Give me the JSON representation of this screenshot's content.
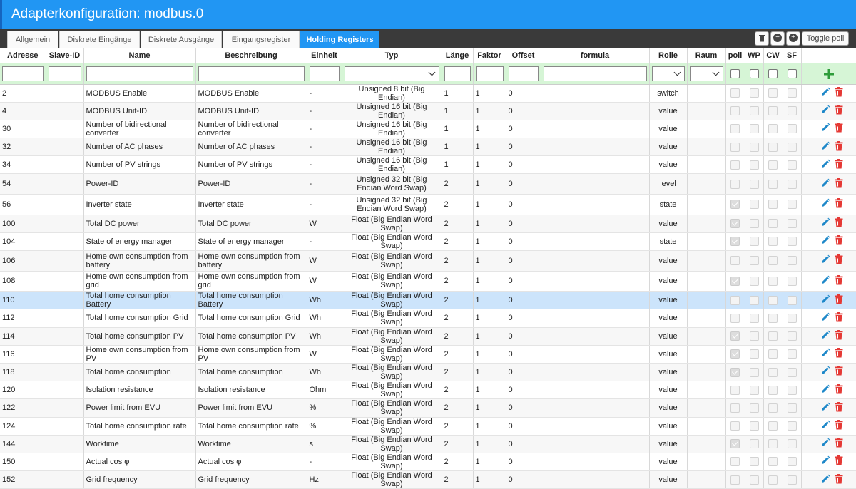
{
  "title": "Adapterkonfiguration: modbus.0",
  "tabs": [
    {
      "label": "Allgemein"
    },
    {
      "label": "Diskrete Eingänge"
    },
    {
      "label": "Diskrete Ausgänge"
    },
    {
      "label": "Eingangsregister"
    },
    {
      "label": "Holding Registers"
    }
  ],
  "toolbar": {
    "toggle_poll": "Toggle poll"
  },
  "columns": [
    "Adresse",
    "Slave-ID",
    "Name",
    "Beschreibung",
    "Einheit",
    "Typ",
    "Länge",
    "Faktor",
    "Offset",
    "formula",
    "Rolle",
    "Raum",
    "poll",
    "WP",
    "CW",
    "SF"
  ],
  "rows": [
    {
      "addr": "2",
      "name": "MODBUS Enable",
      "desc": "MODBUS Enable",
      "unit": "-",
      "type": "Unsigned 8 bit (Big Endian)",
      "len": "1",
      "factor": "1",
      "offset": "0",
      "role": "switch",
      "poll": false
    },
    {
      "addr": "4",
      "name": "MODBUS Unit-ID",
      "desc": "MODBUS Unit-ID",
      "unit": "-",
      "type": "Unsigned 16 bit (Big Endian)",
      "len": "1",
      "factor": "1",
      "offset": "0",
      "role": "value",
      "poll": false
    },
    {
      "addr": "30",
      "name": "Number of bidirectional converter",
      "desc": "Number of bidirectional converter",
      "unit": "-",
      "type": "Unsigned 16 bit (Big Endian)",
      "len": "1",
      "factor": "1",
      "offset": "0",
      "role": "value",
      "poll": false
    },
    {
      "addr": "32",
      "name": "Number of AC phases",
      "desc": "Number of AC phases",
      "unit": "-",
      "type": "Unsigned 16 bit (Big Endian)",
      "len": "1",
      "factor": "1",
      "offset": "0",
      "role": "value",
      "poll": false
    },
    {
      "addr": "34",
      "name": "Number of PV strings",
      "desc": "Number of PV strings",
      "unit": "-",
      "type": "Unsigned 16 bit (Big Endian)",
      "len": "1",
      "factor": "1",
      "offset": "0",
      "role": "value",
      "poll": false
    },
    {
      "addr": "54",
      "name": "Power-ID",
      "desc": "Power-ID",
      "unit": "-",
      "type": "Unsigned 32 bit (Big Endian Word Swap)",
      "len": "2",
      "factor": "1",
      "offset": "0",
      "role": "level",
      "poll": false,
      "tall": true
    },
    {
      "addr": "56",
      "name": "Inverter state",
      "desc": "Inverter state",
      "unit": "-",
      "type": "Unsigned 32 bit (Big Endian Word Swap)",
      "len": "2",
      "factor": "1",
      "offset": "0",
      "role": "state",
      "poll": true,
      "tall": true
    },
    {
      "addr": "100",
      "name": "Total DC power",
      "desc": "Total DC power",
      "unit": "W",
      "type": "Float (Big Endian Word Swap)",
      "len": "2",
      "factor": "1",
      "offset": "0",
      "role": "value",
      "poll": true
    },
    {
      "addr": "104",
      "name": "State of energy manager",
      "desc": "State of energy manager",
      "unit": "-",
      "type": "Float (Big Endian Word Swap)",
      "len": "2",
      "factor": "1",
      "offset": "0",
      "role": "state",
      "poll": true
    },
    {
      "addr": "106",
      "name": "Home own consumption from battery",
      "desc": "Home own consumption from battery",
      "unit": "W",
      "type": "Float (Big Endian Word Swap)",
      "len": "2",
      "factor": "1",
      "offset": "0",
      "role": "value",
      "poll": false,
      "tall": true
    },
    {
      "addr": "108",
      "name": "Home own consumption from grid",
      "desc": "Home own consumption from grid",
      "unit": "W",
      "type": "Float (Big Endian Word Swap)",
      "len": "2",
      "factor": "1",
      "offset": "0",
      "role": "value",
      "poll": true,
      "tall": true
    },
    {
      "addr": "110",
      "name": "Total home consumption Battery",
      "desc": "Total home consumption Battery",
      "unit": "Wh",
      "type": "Float (Big Endian Word Swap)",
      "len": "2",
      "factor": "1",
      "offset": "0",
      "role": "value",
      "poll": false,
      "selected": true
    },
    {
      "addr": "112",
      "name": "Total home consumption Grid",
      "desc": "Total home consumption Grid",
      "unit": "Wh",
      "type": "Float (Big Endian Word Swap)",
      "len": "2",
      "factor": "1",
      "offset": "0",
      "role": "value",
      "poll": false
    },
    {
      "addr": "114",
      "name": "Total home consumption PV",
      "desc": "Total home consumption PV",
      "unit": "Wh",
      "type": "Float (Big Endian Word Swap)",
      "len": "2",
      "factor": "1",
      "offset": "0",
      "role": "value",
      "poll": true
    },
    {
      "addr": "116",
      "name": "Home own consumption from PV",
      "desc": "Home own consumption from PV",
      "unit": "W",
      "type": "Float (Big Endian Word Swap)",
      "len": "2",
      "factor": "1",
      "offset": "0",
      "role": "value",
      "poll": true
    },
    {
      "addr": "118",
      "name": "Total home consumption",
      "desc": "Total home consumption",
      "unit": "Wh",
      "type": "Float (Big Endian Word Swap)",
      "len": "2",
      "factor": "1",
      "offset": "0",
      "role": "value",
      "poll": true
    },
    {
      "addr": "120",
      "name": "Isolation resistance",
      "desc": "Isolation resistance",
      "unit": "Ohm",
      "type": "Float (Big Endian Word Swap)",
      "len": "2",
      "factor": "1",
      "offset": "0",
      "role": "value",
      "poll": false
    },
    {
      "addr": "122",
      "name": "Power limit from EVU",
      "desc": "Power limit from EVU",
      "unit": "%",
      "type": "Float (Big Endian Word Swap)",
      "len": "2",
      "factor": "1",
      "offset": "0",
      "role": "value",
      "poll": false
    },
    {
      "addr": "124",
      "name": "Total home consumption rate",
      "desc": "Total home consumption rate",
      "unit": "%",
      "type": "Float (Big Endian Word Swap)",
      "len": "2",
      "factor": "1",
      "offset": "0",
      "role": "value",
      "poll": false
    },
    {
      "addr": "144",
      "name": "Worktime",
      "desc": "Worktime",
      "unit": "s",
      "type": "Float (Big Endian Word Swap)",
      "len": "2",
      "factor": "1",
      "offset": "0",
      "role": "value",
      "poll": true
    },
    {
      "addr": "150",
      "name": "Actual cos φ",
      "desc": "Actual cos φ",
      "unit": "-",
      "type": "Float (Big Endian Word Swap)",
      "len": "2",
      "factor": "1",
      "offset": "0",
      "role": "value",
      "poll": false
    },
    {
      "addr": "152",
      "name": "Grid frequency",
      "desc": "Grid frequency",
      "unit": "Hz",
      "type": "Float (Big Endian Word Swap)",
      "len": "2",
      "factor": "1",
      "offset": "0",
      "role": "value",
      "poll": false
    }
  ],
  "colors": {
    "accent": "#2196f3",
    "filter_bg": "#d6f5d6",
    "selected_row": "#cce4fb",
    "edit_icon": "#1e88c9",
    "delete_icon": "#e53935",
    "add_icon": "#2e9c3a"
  },
  "icons": {
    "edit": "pencil-icon",
    "delete": "trash-icon",
    "add": "plus-icon",
    "toolbar": [
      "trash-icon",
      "minus-circle-icon",
      "plus-circle-icon"
    ]
  }
}
